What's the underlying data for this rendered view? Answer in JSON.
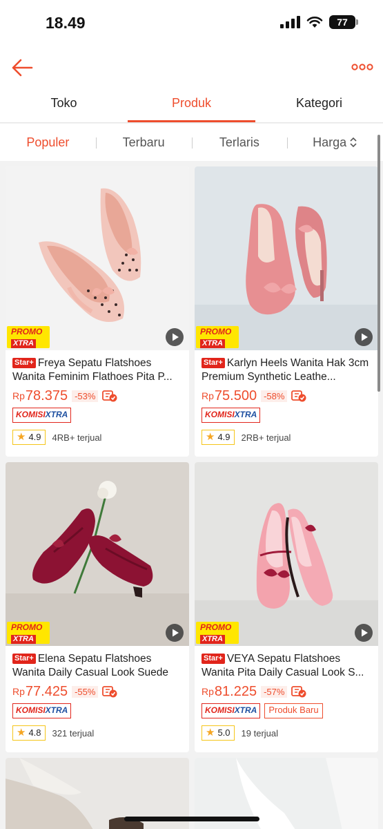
{
  "status": {
    "time": "18.49",
    "battery": "77"
  },
  "header": {
    "back_icon": "arrow-left-icon",
    "more_icon": "more-dots-icon",
    "accent": "#ee4d2d"
  },
  "tabs": [
    {
      "label": "Toko",
      "active": false
    },
    {
      "label": "Produk",
      "active": true
    },
    {
      "label": "Kategori",
      "active": false
    }
  ],
  "sort": [
    {
      "label": "Populer",
      "active": true
    },
    {
      "label": "Terbaru",
      "active": false
    },
    {
      "label": "Terlaris",
      "active": false
    },
    {
      "label": "Harga",
      "active": false
    }
  ],
  "badges": {
    "promo_line1": "PROMO",
    "promo_line2": "XTRA",
    "star_plus": "Star+",
    "komisi_a": "KOMISI",
    "komisi_b": "XTRA",
    "currency": "Rp"
  },
  "products": [
    {
      "title": "Freya Sepatu Flatshoes Wanita Feminim Flathoes Pita P...",
      "price": "78.375",
      "discount": "-53%",
      "produk_baru": "",
      "rating": "4.9",
      "sold": "4RB+ terjual"
    },
    {
      "title": "Karlyn Heels Wanita Hak 3cm Premium Synthetic Leathe...",
      "price": "75.500",
      "discount": "-58%",
      "produk_baru": "",
      "rating": "4.9",
      "sold": "2RB+ terjual"
    },
    {
      "title": "Elena Sepatu Flatshoes Wanita Daily Casual Look Suede",
      "price": "77.425",
      "discount": "-55%",
      "produk_baru": "",
      "rating": "4.8",
      "sold": "321 terjual"
    },
    {
      "title": "VEYA Sepatu Flatshoes Wanita Pita Daily Casual Look S...",
      "price": "81.225",
      "discount": "-57%",
      "produk_baru": "Produk Baru",
      "rating": "5.0",
      "sold": "19 terjual"
    }
  ]
}
